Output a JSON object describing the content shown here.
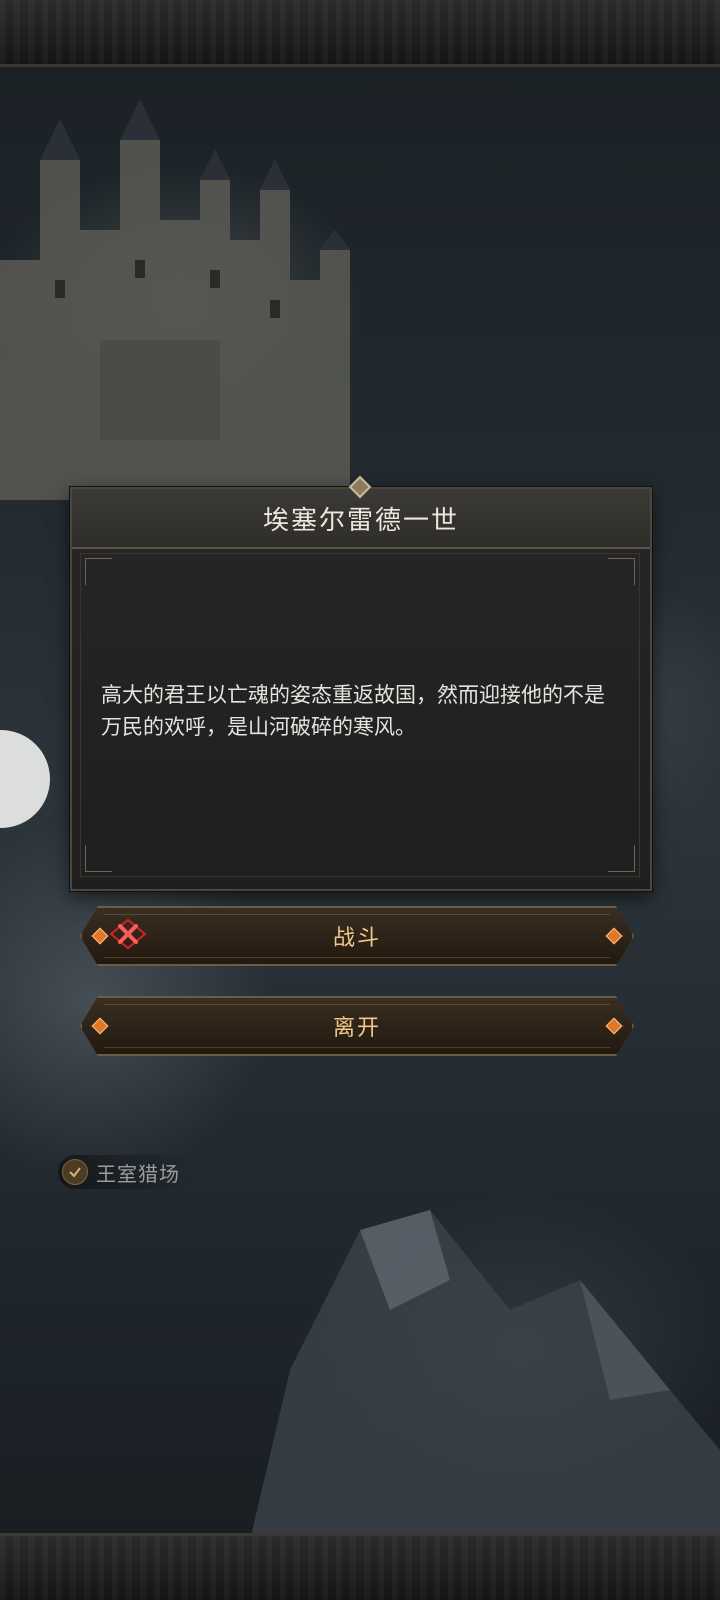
{
  "event_dialog": {
    "title": "埃塞尔雷德一世",
    "description": "高大的君王以亡魂的姿态重返故国，然而迎接他的不是万民的欢呼，是山河破碎的寒风。"
  },
  "actions": {
    "fight_label": "战斗",
    "leave_label": "离开"
  },
  "map": {
    "location_label": "王室猎场",
    "location_status_icon": "check-icon"
  },
  "colors": {
    "button_text": "#f2c78a",
    "gem_accent": "#e0782c",
    "fight_icon": "#d8202a"
  }
}
